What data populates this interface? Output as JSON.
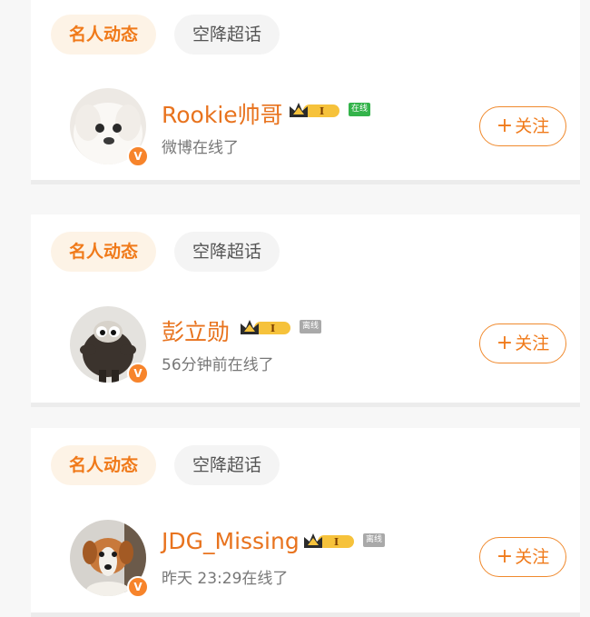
{
  "tabs": {
    "active": "名人动态",
    "inactive": "空降超话"
  },
  "users": [
    {
      "name": "Rookie帅哥",
      "status": "微博在线了",
      "online_label": "在线",
      "level": "I",
      "follow_label": "关注",
      "online": true
    },
    {
      "name": "彭立勋",
      "status": "56分钟前在线了",
      "online_label": "离线",
      "level": "I",
      "follow_label": "关注",
      "online": false
    },
    {
      "name": "JDG_Missing",
      "status": "昨天 23:29在线了",
      "online_label": "离线",
      "level": "I",
      "follow_label": "关注",
      "online": false
    }
  ],
  "verify_badge": "V",
  "follow_plus": "+",
  "colors": {
    "accent": "#f07a1a",
    "tab_active_bg": "#fdf3e6",
    "online": "#33b34a",
    "offline": "#a9a9a9"
  }
}
